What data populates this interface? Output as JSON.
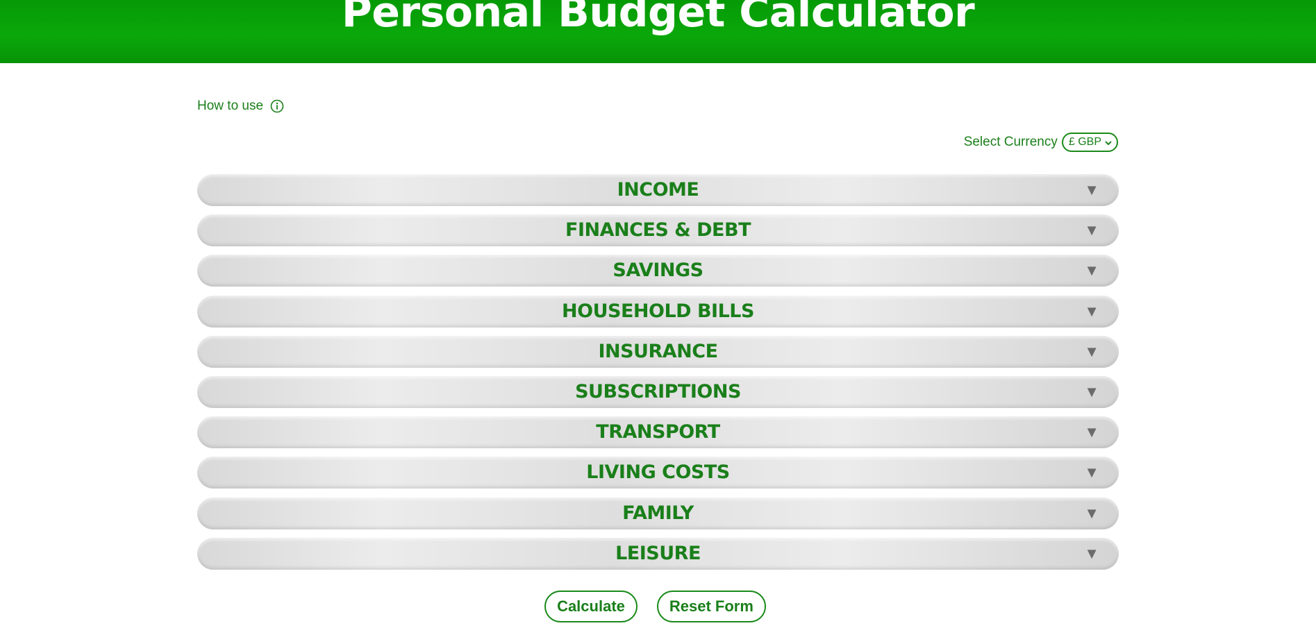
{
  "header": {
    "title": "Personal Budget Calculator"
  },
  "help": {
    "label": "How to use",
    "icon": "info-icon"
  },
  "currency": {
    "label": "Select Currency",
    "selected": "£ GBP",
    "icon": "chevron-down-icon"
  },
  "sections": [
    {
      "label": "INCOME",
      "arrow": "▼"
    },
    {
      "label": "FINANCES & DEBT",
      "arrow": "▼"
    },
    {
      "label": "SAVINGS",
      "arrow": "▼"
    },
    {
      "label": "HOUSEHOLD BILLS",
      "arrow": "▼"
    },
    {
      "label": "INSURANCE",
      "arrow": "▼"
    },
    {
      "label": "SUBSCRIPTIONS",
      "arrow": "▼"
    },
    {
      "label": "TRANSPORT",
      "arrow": "▼"
    },
    {
      "label": "LIVING COSTS",
      "arrow": "▼"
    },
    {
      "label": "FAMILY",
      "arrow": "▼"
    },
    {
      "label": "LEISURE",
      "arrow": "▼"
    }
  ],
  "actions": {
    "calculate_label": "Calculate",
    "reset_label": "Reset Form"
  },
  "colors": {
    "brand_green": "#0aa80a",
    "text_green": "#1a7f1a",
    "arrow_gray": "#6b6b6b"
  }
}
